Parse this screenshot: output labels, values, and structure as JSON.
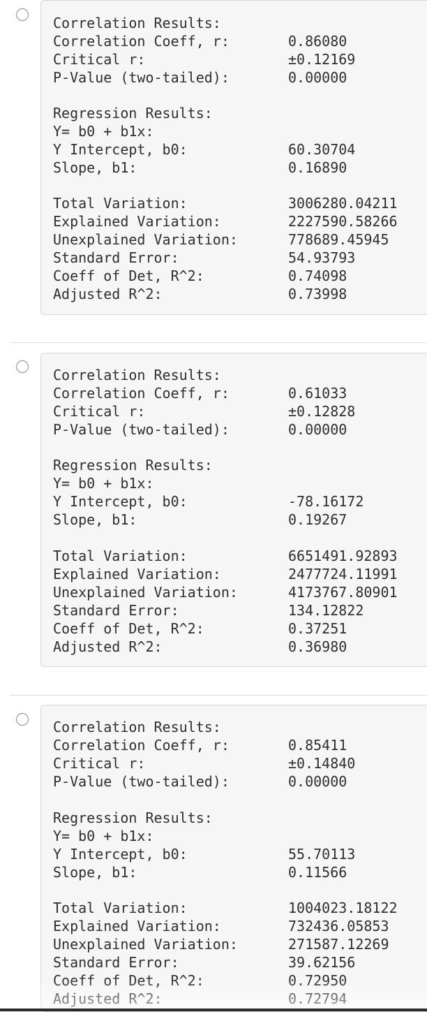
{
  "options": [
    {
      "corr_header": "Correlation Results:",
      "corr_coeff_label": "Correlation Coeff, r:",
      "corr_coeff_value": "0.86080",
      "critical_label": "Critical r:",
      "critical_value": "±0.12169",
      "pvalue_label": "P-Value (two-tailed):",
      "pvalue_value": "0.00000",
      "reg_header": "Regression Results:",
      "equation": "Y= b0 + b1x:",
      "intercept_label": "Y Intercept, b0:",
      "intercept_value": "60.30704",
      "slope_label": "Slope, b1:",
      "slope_value": "0.16890",
      "total_var_label": "Total Variation:",
      "total_var_value": "3006280.04211",
      "explained_var_label": "Explained Variation:",
      "explained_var_value": "2227590.58266",
      "unexplained_var_label": "Unexplained Variation:",
      "unexplained_var_value": "778689.45945",
      "std_error_label": "Standard Error:",
      "std_error_value": "54.93793",
      "r2_label": "Coeff of Det, R^2:",
      "r2_value": "0.74098",
      "adj_r2_label": "Adjusted R^2:",
      "adj_r2_value": "0.73998"
    },
    {
      "corr_header": "Correlation Results:",
      "corr_coeff_label": "Correlation Coeff, r:",
      "corr_coeff_value": "0.61033",
      "critical_label": "Critical r:",
      "critical_value": "±0.12828",
      "pvalue_label": "P-Value (two-tailed):",
      "pvalue_value": "0.00000",
      "reg_header": "Regression Results:",
      "equation": "Y= b0 + b1x:",
      "intercept_label": "Y Intercept, b0:",
      "intercept_value": "-78.16172",
      "slope_label": "Slope, b1:",
      "slope_value": "0.19267",
      "total_var_label": "Total Variation:",
      "total_var_value": "6651491.92893",
      "explained_var_label": "Explained Variation:",
      "explained_var_value": "2477724.11991",
      "unexplained_var_label": "Unexplained Variation:",
      "unexplained_var_value": "4173767.80901",
      "std_error_label": "Standard Error:",
      "std_error_value": "134.12822",
      "r2_label": "Coeff of Det, R^2:",
      "r2_value": "0.37251",
      "adj_r2_label": "Adjusted R^2:",
      "adj_r2_value": "0.36980"
    },
    {
      "corr_header": "Correlation Results:",
      "corr_coeff_label": "Correlation Coeff, r:",
      "corr_coeff_value": "0.85411",
      "critical_label": "Critical r:",
      "critical_value": "±0.14840",
      "pvalue_label": "P-Value (two-tailed):",
      "pvalue_value": "0.00000",
      "reg_header": "Regression Results:",
      "equation": "Y= b0 + b1x:",
      "intercept_label": "Y Intercept, b0:",
      "intercept_value": "55.70113",
      "slope_label": "Slope, b1:",
      "slope_value": "0.11566",
      "total_var_label": "Total Variation:",
      "total_var_value": "1004023.18122",
      "explained_var_label": "Explained Variation:",
      "explained_var_value": "732436.05853",
      "unexplained_var_label": "Unexplained Variation:",
      "unexplained_var_value": "271587.12269",
      "std_error_label": "Standard Error:",
      "std_error_value": "39.62156",
      "r2_label": "Coeff of Det, R^2:",
      "r2_value": "0.72950",
      "adj_r2_label": "Adjusted R^2:",
      "adj_r2_value": "0.72794"
    }
  ]
}
